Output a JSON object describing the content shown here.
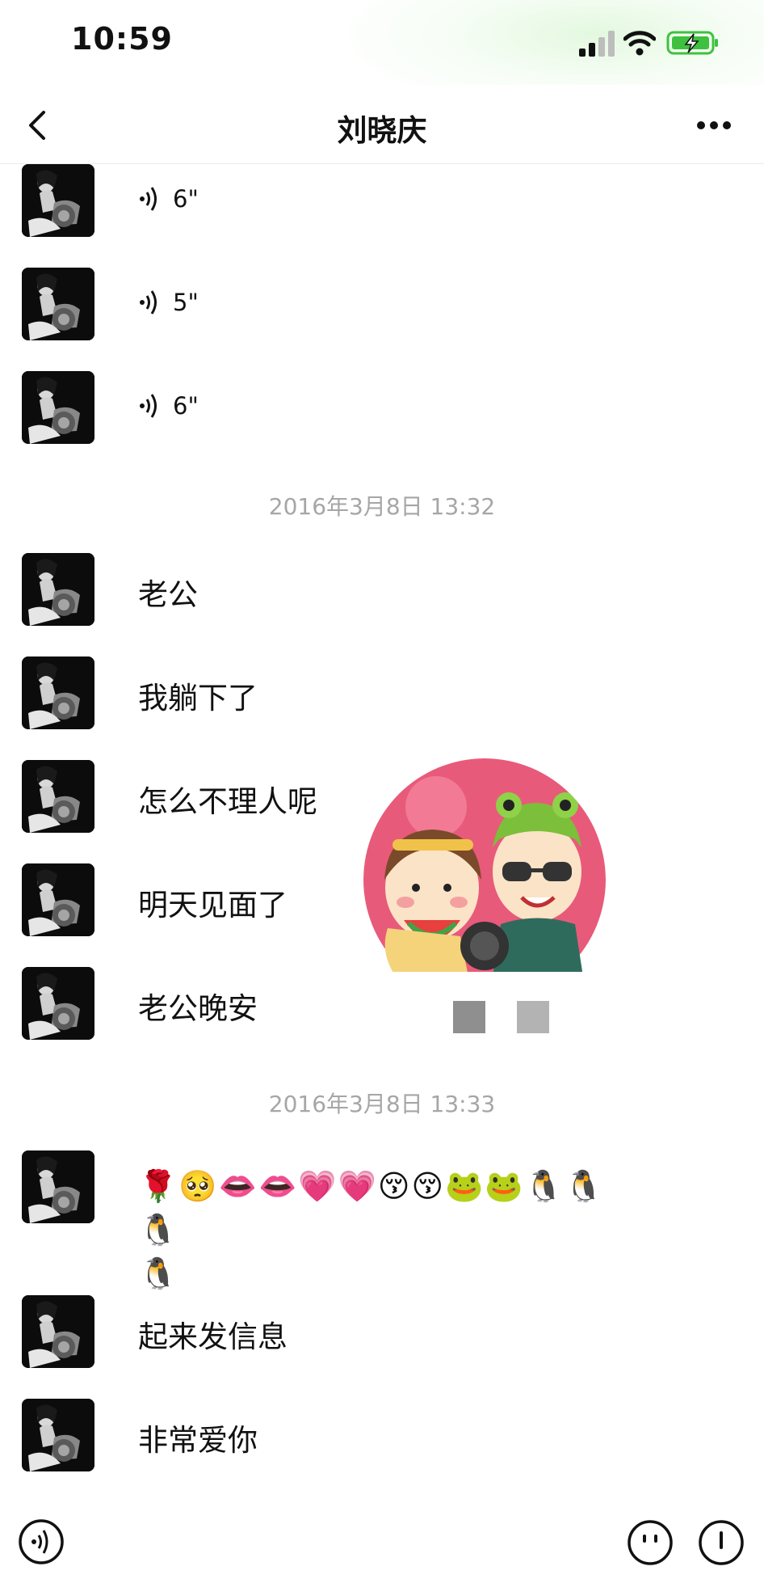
{
  "status_bar": {
    "time": "10:59"
  },
  "nav": {
    "title": "刘晓庆"
  },
  "messages": {
    "voice": [
      {
        "duration": "6\""
      },
      {
        "duration": "5\""
      },
      {
        "duration": "6\""
      }
    ],
    "timestamp_1": "2016年3月8日 13:32",
    "text_1": "老公",
    "text_2": "我躺下了",
    "text_3": "怎么不理人呢",
    "text_4": "明天见面了",
    "text_5": "老公晚安",
    "timestamp_2": "2016年3月8日 13:33",
    "emoji_line": "🌹🥺👄👄💗💗😚😚🐸🐸🐧🐧🐧",
    "emoji_line_2": "🐧",
    "text_6": "起来发信息",
    "text_7": "非常爱你"
  },
  "colors": {
    "timestamp": "#a6a6a6",
    "battery": "#3fc13f",
    "overlay_bg": "#e85a7a"
  },
  "icons": {
    "back": "chevron-left-icon",
    "more": "more-dots-icon",
    "voice_wave": "voice-wave-icon",
    "voice_input": "voice-input-icon",
    "emoji": "emoji-icon",
    "plus": "plus-icon"
  }
}
